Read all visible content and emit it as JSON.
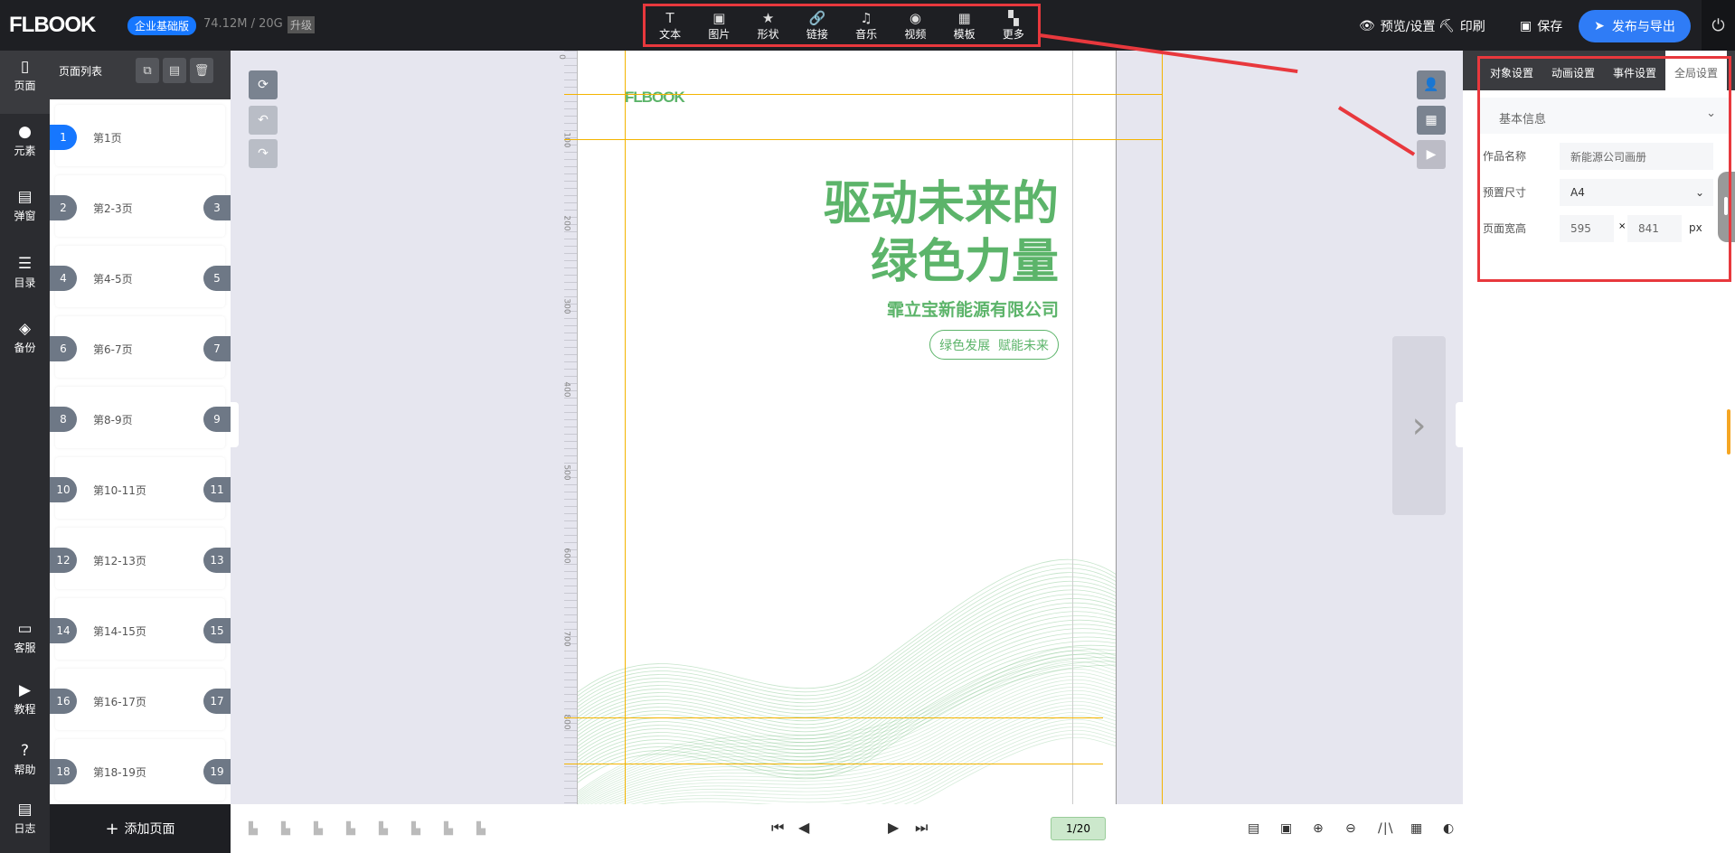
{
  "header": {
    "logo": "FLBOOK",
    "edition": "企业基础版",
    "storage": "74.12M / 20G",
    "upgrade": "升级",
    "tools": [
      {
        "label": "文本",
        "icon": "text-icon"
      },
      {
        "label": "图片",
        "icon": "image-icon"
      },
      {
        "label": "形状",
        "icon": "star-icon"
      },
      {
        "label": "链接",
        "icon": "link-icon"
      },
      {
        "label": "音乐",
        "icon": "music-icon"
      },
      {
        "label": "视频",
        "icon": "video-icon"
      },
      {
        "label": "模板",
        "icon": "template-icon"
      },
      {
        "label": "更多",
        "icon": "more-icon"
      }
    ],
    "preview": "预览/设置",
    "print": "印刷",
    "save": "保存",
    "publish": "发布与导出"
  },
  "sidebar": {
    "top": [
      "页面",
      "元素",
      "弹窗",
      "目录",
      "备份"
    ],
    "bottom": [
      "客服",
      "教程",
      "帮助",
      "日志"
    ]
  },
  "pagelist": {
    "title": "页面列表",
    "add": "添加页面",
    "items": [
      {
        "l": "1",
        "label": "第1页"
      },
      {
        "l": "2",
        "label": "第2-3页",
        "r": "3"
      },
      {
        "l": "4",
        "label": "第4-5页",
        "r": "5"
      },
      {
        "l": "6",
        "label": "第6-7页",
        "r": "7"
      },
      {
        "l": "8",
        "label": "第8-9页",
        "r": "9"
      },
      {
        "l": "10",
        "label": "第10-11页",
        "r": "11"
      },
      {
        "l": "12",
        "label": "第12-13页",
        "r": "13"
      },
      {
        "l": "14",
        "label": "第14-15页",
        "r": "15"
      },
      {
        "l": "16",
        "label": "第16-17页",
        "r": "17"
      },
      {
        "l": "18",
        "label": "第18-19页",
        "r": "19"
      }
    ]
  },
  "ruler": [
    "0",
    "100",
    "200",
    "300",
    "400",
    "500",
    "600",
    "700",
    "800"
  ],
  "page": {
    "logo": "FLBOOK",
    "title1": "驱动未来的",
    "title2": "绿色力量",
    "company": "霏立宝新能源有限公司",
    "slogan": "绿色发展  赋能未来",
    "green": "#5cb46a"
  },
  "pager": {
    "current": "1/20"
  },
  "panel": {
    "tabs": [
      "对象设置",
      "动画设置",
      "事件设置",
      "全局设置"
    ],
    "active": 3,
    "section": "基本信息",
    "name_label": "作品名称",
    "name_value": "新能源公司画册",
    "size_label": "预置尺寸",
    "size_value": "A4",
    "wh_label": "页面宽高",
    "width": "595",
    "x": "×",
    "height": "841",
    "unit": "px"
  }
}
